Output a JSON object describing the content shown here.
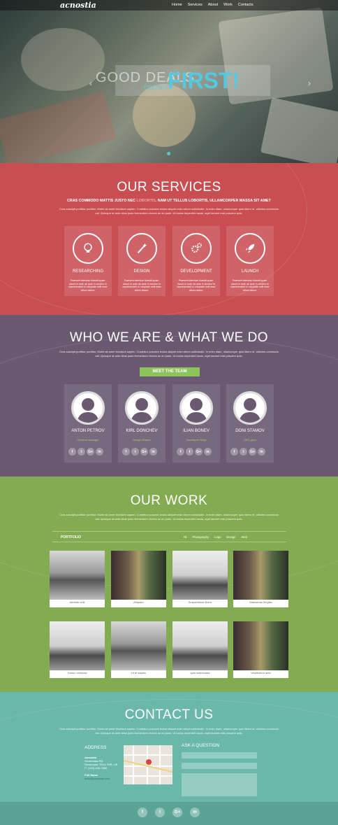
{
  "nav": {
    "logo": "acnostia",
    "items": [
      "Home",
      "Services",
      "About",
      "Work",
      "Contacts"
    ]
  },
  "hero": {
    "line1": "GOOD DEALS",
    "line2": "comes",
    "line3": "FIRST!",
    "prev": "‹",
    "next": "›"
  },
  "services": {
    "title": "OUR SERVICES",
    "sub_a": "CRAS COMMODO MATTIS JUSTO NEC ",
    "sub_b": "LOBORTIS",
    "sub_c": ". NAM UT TELLUS LOBORTIS, ULLAMCORPER MASSA SIT AMET",
    "para": "Cras suscipit porttitor porttitor. Morbi sit amet tincidunt sapien. Curabitur posuere lectus aliquet erat rutrum sollicitudin. In enim diam, ullamcorper quis libero et, ultricies commodo est. Quisque at ante vitae justo fermentum viverra ac eu justo. Ut luctus imperdiet lacus, eget laoreet erat posuere quis.",
    "items": [
      {
        "title": "RESEARCHING",
        "icon": "lightbulb-icon",
        "text": "Praesent interdum blandit quam. Aeunt in ante ulx ante in zendior in reprehenderit in voluptate velit esse cillum dolore."
      },
      {
        "title": "DESIGN",
        "icon": "magic-wand-icon",
        "text": "Praesent interdum blandit quam. Aeunt in ante ulx ante in zendior in reprehenderit in voluptate velit esse cillum dolore."
      },
      {
        "title": "DEVELOPMENT",
        "icon": "gears-icon",
        "text": "Praesent interdum blandit quam. Aeunt in ante ulx ante in zendior in reprehenderit in voluptate velit esse cillum dolore."
      },
      {
        "title": "LAUNCH",
        "icon": "rocket-icon",
        "text": "Praesent interdum blandit quam. Aeunt in ante ulx ante in zendior in reprehenderit in voluptate velit esse cillum dolore."
      }
    ]
  },
  "team": {
    "title": "WHO WE ARE & WHAT WE DO",
    "para": "Cras suscipit porttitor porttitor. Morbi sit amet tincidunt sapien. Curabitur posuere lectus aliquet erat rutrum sollicitudin. In enim diam, ullamcorper quis libero et, ultricies commodo est. Quisque at ante vitae justo fermentum viverra ac eu justo. Ut luctus imperdiet lacus, eget laoreet erat posuere quis.",
    "button": "MEET THE TEAM",
    "members": [
      {
        "name": "ANTON PETROV",
        "role": "General manager"
      },
      {
        "name": "KIRL DONCHEV",
        "role": "Design Master"
      },
      {
        "name": "ILIAN BONEV",
        "role": "Developer Ninja"
      },
      {
        "name": "DONI STAMOV",
        "role": "SEO guru"
      }
    ],
    "social": [
      "f",
      "t",
      "G+",
      "in"
    ]
  },
  "work": {
    "title": "OUR WORK",
    "para": "Cras suscipit porttitor porttitor. Morbi sit amet tincidunt sapien. Curabitur posuere lectus aliquet erat rutrum sollicitudin. In enim diam, ullamcorper quis libero et, ultricies commodo est. Quisque at ante vitae justo fermentum viverra ac eu justo. Ut luctus imperdiet lacus, eget laoreet erat posuere quis.",
    "portfolio": "PORTFOLIO",
    "filters": [
      "All",
      "Photography",
      "Logo",
      "Design",
      "Web"
    ],
    "items": [
      {
        "caption": "Aenean velit",
        "style": "mist"
      },
      {
        "caption": "Aliquam",
        "style": "forest"
      },
      {
        "caption": "Suspendisse libero",
        "style": "bird"
      },
      {
        "caption": "Maecenas fringilla",
        "style": "forest"
      },
      {
        "caption": "Donec vehicula",
        "style": "bird"
      },
      {
        "caption": "Ut et sapien",
        "style": "mist"
      },
      {
        "caption": "quis malesuada",
        "style": "bird"
      },
      {
        "caption": "Vestibulum ante",
        "style": "forest"
      }
    ]
  },
  "contact": {
    "title": "CONTACT US",
    "para": "Cras suscipit porttitor porttitor. Morbi sit amet tincidunt sapien. Curabitur posuere lectus aliquet erat rutrum sollicitudin. In enim diam, ullamcorper quis libero et, ultricies commodo est. Quisque at ante vitae justo fermentum viverra ac eu justo. Ut luctus imperdiet lacus, eget laoreet erat posuere quis.",
    "address_label": "ADDRESS",
    "company": "Acnostia",
    "street": "Sevenoaks Rd",
    "city": "Sevenoaks TN14 7HR, UK",
    "phone": "P: (123) 456-7890",
    "fullname_label": "Full Name",
    "email": "hello@acnostia.com",
    "ask": "ASK A QUESTION",
    "name_ph": "Name",
    "email_ph": "Email",
    "message_ph": "Message"
  },
  "footer": {
    "social": [
      "f",
      "t",
      "G+",
      "in"
    ]
  }
}
